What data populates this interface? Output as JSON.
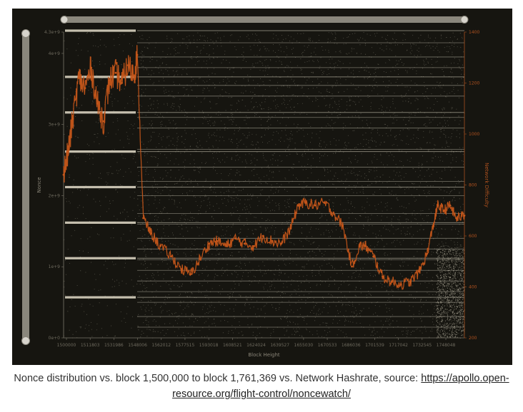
{
  "caption": {
    "text": "Nonce distribution vs. block 1,500,000 to block 1,761,369 vs. Network Hashrate, source: ",
    "link": "https://apollo.open-resource.org/flight-control/noncewatch/"
  },
  "chart_data": {
    "type": "scatter",
    "xlabel": "Block Height",
    "ylabel": "Nonce",
    "y2label": "Network Difficulty",
    "xlim": [
      1500000,
      1761369
    ],
    "ylim": [
      0,
      4300000000
    ],
    "y2lim": [
      200,
      1400
    ],
    "x_ticks": [
      "1500000",
      "1511803",
      "1531986",
      "1548006",
      "1562012",
      "1577515",
      "1593018",
      "1608521",
      "1624024",
      "1639527",
      "1655030",
      "1670533",
      "1686036",
      "1701539",
      "1717042",
      "1732545",
      "1748048"
    ],
    "y_ticks": [
      "0e+0",
      "1e+9",
      "2e+9",
      "3e+9",
      "4e+9",
      "4.3e+9"
    ],
    "y2_ticks": [
      "200",
      "400",
      "600",
      "800",
      "1000",
      "1200",
      "1400"
    ],
    "series": [
      {
        "name": "Network Difficulty",
        "color": "#c6561a",
        "x": [
          1500000,
          1503000,
          1506000,
          1510000,
          1514000,
          1518000,
          1522000,
          1526000,
          1530000,
          1534000,
          1538000,
          1542000,
          1546000,
          1548000,
          1552000,
          1557000,
          1563000,
          1570000,
          1577000,
          1583000,
          1589000,
          1595000,
          1600000,
          1606000,
          1612000,
          1618000,
          1624000,
          1630000,
          1636000,
          1642000,
          1648000,
          1653000,
          1658000,
          1664000,
          1670000,
          1676000,
          1682000,
          1688000,
          1693000,
          1697000,
          1702000,
          1708000,
          1714000,
          1720000,
          1726000,
          1732000,
          1737000,
          1741000,
          1744000,
          1748000,
          1752000,
          1756000,
          1761369
        ],
        "values": [
          840,
          930,
          1060,
          1220,
          1180,
          1260,
          1120,
          1050,
          1210,
          1240,
          1200,
          1270,
          1230,
          1310,
          670,
          610,
          560,
          520,
          470,
          450,
          510,
          570,
          580,
          560,
          590,
          570,
          560,
          600,
          580,
          570,
          630,
          720,
          730,
          720,
          730,
          690,
          640,
          480,
          560,
          560,
          520,
          440,
          420,
          410,
          420,
          460,
          530,
          640,
          720,
          700,
          720,
          670,
          680
        ]
      }
    ],
    "bands": {
      "name": "Nonce distribution",
      "y_values": [
        150000000,
        300000000,
        500000000,
        650000000,
        800000000,
        950000000,
        1100000000,
        1250000000,
        1400000000,
        1600000000,
        1750000000,
        2000000000,
        2200000000,
        2400000000,
        2650000000,
        2950000000,
        3100000000,
        3400000000,
        3550000000,
        3800000000,
        3950000000,
        4150000000
      ],
      "strong_left": [
        550000000,
        1100000000,
        1600000000,
        2100000000,
        2600000000,
        3150000000,
        3650000000,
        4300000000
      ]
    },
    "grid": false
  },
  "colors": {
    "background": "#161510",
    "scatter": "#8c8878",
    "difficulty": "#c6561a",
    "band": "#d8d2c0",
    "scrollbar": "#8a877c"
  }
}
